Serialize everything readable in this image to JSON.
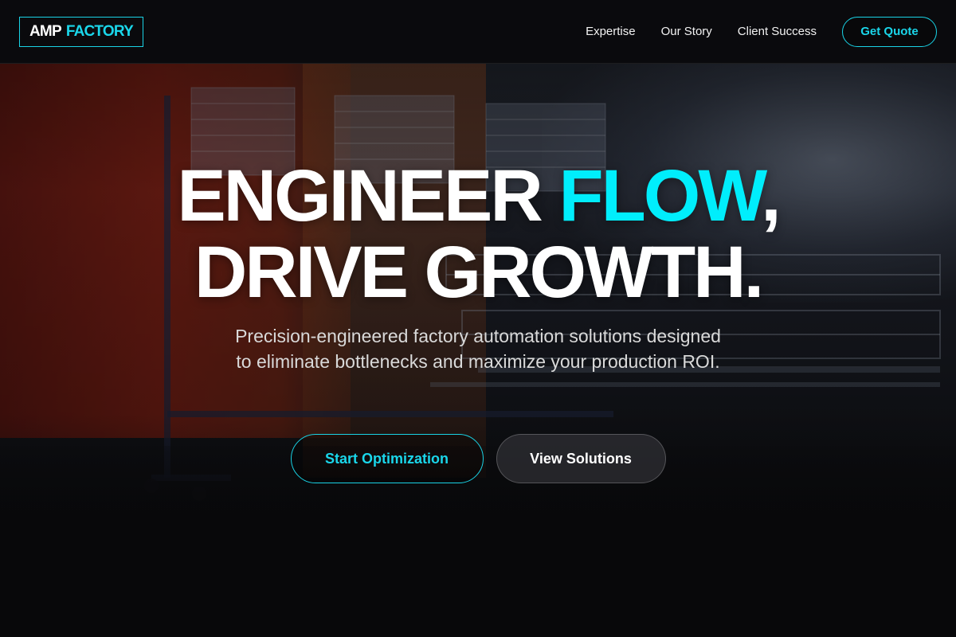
{
  "brand": {
    "part1": "AMP",
    "part2": "FACTORY"
  },
  "nav": {
    "links": [
      "Expertise",
      "Our Story",
      "Client Success"
    ],
    "cta_label": "Get Quote"
  },
  "hero": {
    "line1_word": "ENGINEER",
    "line1_accent": "FLOW",
    "line1_punct": ",",
    "line2": "DRIVE GROWTH.",
    "subtitle": "Precision-engineered factory automation solutions designed to eliminate bottlenecks and maximize your production ROI.",
    "primary_cta": "Start Optimization",
    "secondary_cta": "View Solutions"
  },
  "colors": {
    "accent": "#00eefc",
    "background": "#0a0a0b"
  }
}
